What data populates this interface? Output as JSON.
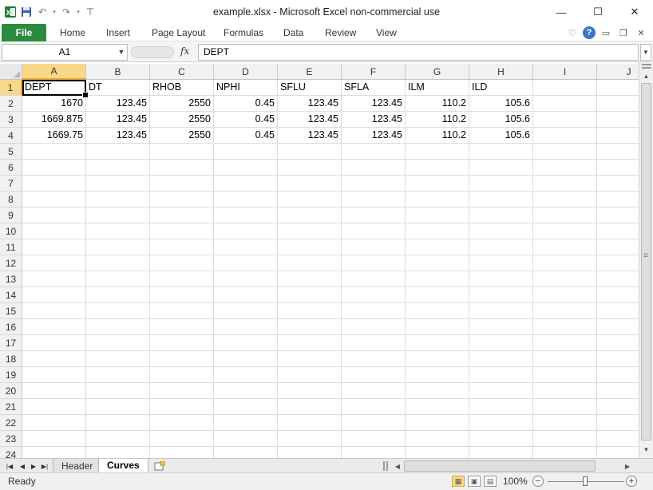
{
  "window": {
    "title": "example.xlsx  -  Microsoft Excel non-commercial use",
    "minimize": "—",
    "maximize": "☐",
    "close": "✕"
  },
  "qat": {
    "app_icon": "excel-icon",
    "save_icon": "save-icon",
    "undo_icon": "undo-icon",
    "redo_icon": "redo-icon",
    "customize_icon": "customize-qat-icon"
  },
  "ribbon": {
    "file_label": "File",
    "tabs": [
      "Home",
      "Insert",
      "Page Layout",
      "Formulas",
      "Data",
      "Review",
      "View"
    ],
    "right_icons": [
      "minimize-ribbon-icon",
      "help-icon",
      "window-minimize-icon",
      "window-restore-icon",
      "window-close-icon"
    ]
  },
  "formula_bar": {
    "name_box": "A1",
    "fx": "fx",
    "content": "DEPT"
  },
  "grid": {
    "columns": [
      "A",
      "B",
      "C",
      "D",
      "E",
      "F",
      "G",
      "H",
      "I",
      "J"
    ],
    "active_column": "A",
    "active_row": 1,
    "row_numbers": [
      "1",
      "2",
      "3",
      "4",
      "5",
      "6",
      "7",
      "8",
      "9",
      "10",
      "11",
      "12",
      "13",
      "14",
      "15",
      "16",
      "17",
      "18",
      "19",
      "20",
      "21",
      "22",
      "23",
      "24"
    ],
    "rows": [
      [
        "DEPT",
        "DT",
        "RHOB",
        "NPHI",
        "SFLU",
        "SFLA",
        "ILM",
        "ILD"
      ],
      [
        "1670",
        "123.45",
        "2550",
        "0.45",
        "123.45",
        "123.45",
        "110.2",
        "105.6"
      ],
      [
        "1669.875",
        "123.45",
        "2550",
        "0.45",
        "123.45",
        "123.45",
        "110.2",
        "105.6"
      ],
      [
        "1669.75",
        "123.45",
        "2550",
        "0.45",
        "123.45",
        "123.45",
        "110.2",
        "105.6"
      ]
    ]
  },
  "sheets": {
    "tabs": [
      "Header",
      "Curves"
    ],
    "active": "Curves"
  },
  "status": {
    "text": "Ready",
    "zoom": "100%",
    "zoom_minus": "−",
    "zoom_plus": "+"
  }
}
